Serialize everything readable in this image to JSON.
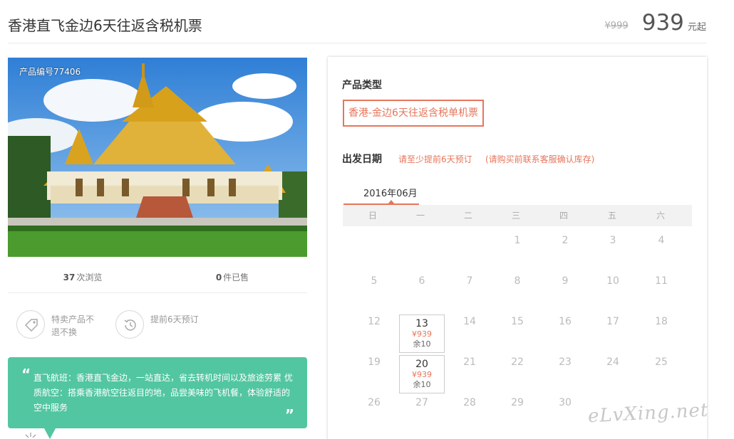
{
  "header": {
    "title": "香港直飞金边6天往返含税机票",
    "old_price": "¥999",
    "price": "939",
    "price_unit": "元起"
  },
  "product": {
    "number": "产品编号77406",
    "views_count": "37",
    "views_label": "次浏览",
    "sold_count": "0",
    "sold_label": "件已售"
  },
  "features": [
    {
      "icon": "tag-icon",
      "text": "特卖产品不退不换"
    },
    {
      "icon": "clock-history-icon",
      "text": "提前6天预订"
    }
  ],
  "description": {
    "open_quote": "“",
    "close_quote": "”",
    "text": "直飞航班：香港直飞金边，一站直达，省去转机时间以及旅途劳累 优质航空：搭乘香港航空往返目的地，品尝美味的飞机餐，体验舒适的空中服务"
  },
  "booking": {
    "product_type_label": "产品类型",
    "product_type_option": "香港-金边6天往返含税单机票",
    "date_label": "出发日期",
    "date_tip": "请至少提前6天预订",
    "date_tip2": "(请购买前联系客服确认库存)",
    "month": "2016年06月",
    "weekdays": [
      "日",
      "一",
      "二",
      "三",
      "四",
      "五",
      "六"
    ],
    "days": [
      "1",
      "2",
      "3",
      "4",
      "5",
      "6",
      "7",
      "8",
      "9",
      "10",
      "11",
      "12",
      "13",
      "14",
      "15",
      "16",
      "17",
      "18",
      "19",
      "20",
      "21",
      "22",
      "23",
      "24",
      "25",
      "26",
      "27",
      "28",
      "29",
      "30"
    ],
    "available": {
      "13": {
        "price": "¥939",
        "stock": "余10"
      },
      "20": {
        "price": "¥939",
        "stock": "余10"
      }
    }
  },
  "watermark": "eLvXing.net",
  "colors": {
    "accent": "#e6765b",
    "teal": "#52c6a0"
  }
}
